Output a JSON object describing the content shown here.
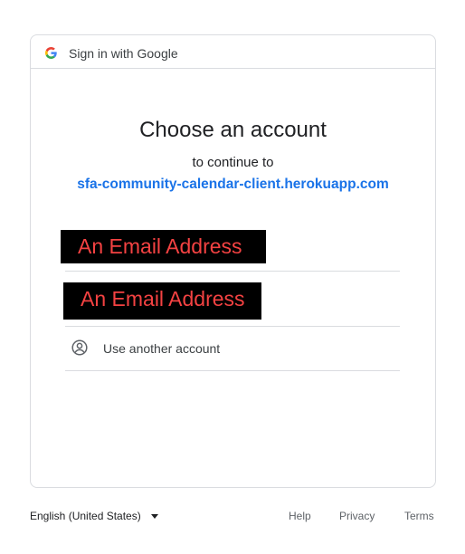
{
  "header": {
    "text": "Sign in with Google",
    "icon": "google-g-icon"
  },
  "title": "Choose an account",
  "subtitle": "to continue to",
  "app_name": "sfa-community-calendar-client.herokuapp.com",
  "accounts": [
    {
      "label": "An Email Address"
    },
    {
      "label": "An Email Address"
    }
  ],
  "use_another": {
    "label": "Use another account",
    "icon": "person-circle-icon"
  },
  "footer": {
    "language": "English (United States)",
    "help": "Help",
    "privacy": "Privacy",
    "terms": "Terms"
  },
  "colors": {
    "accent": "#1a73e8",
    "border": "#dadce0",
    "redaction_bg": "#000000",
    "redaction_text": "#f44242"
  }
}
